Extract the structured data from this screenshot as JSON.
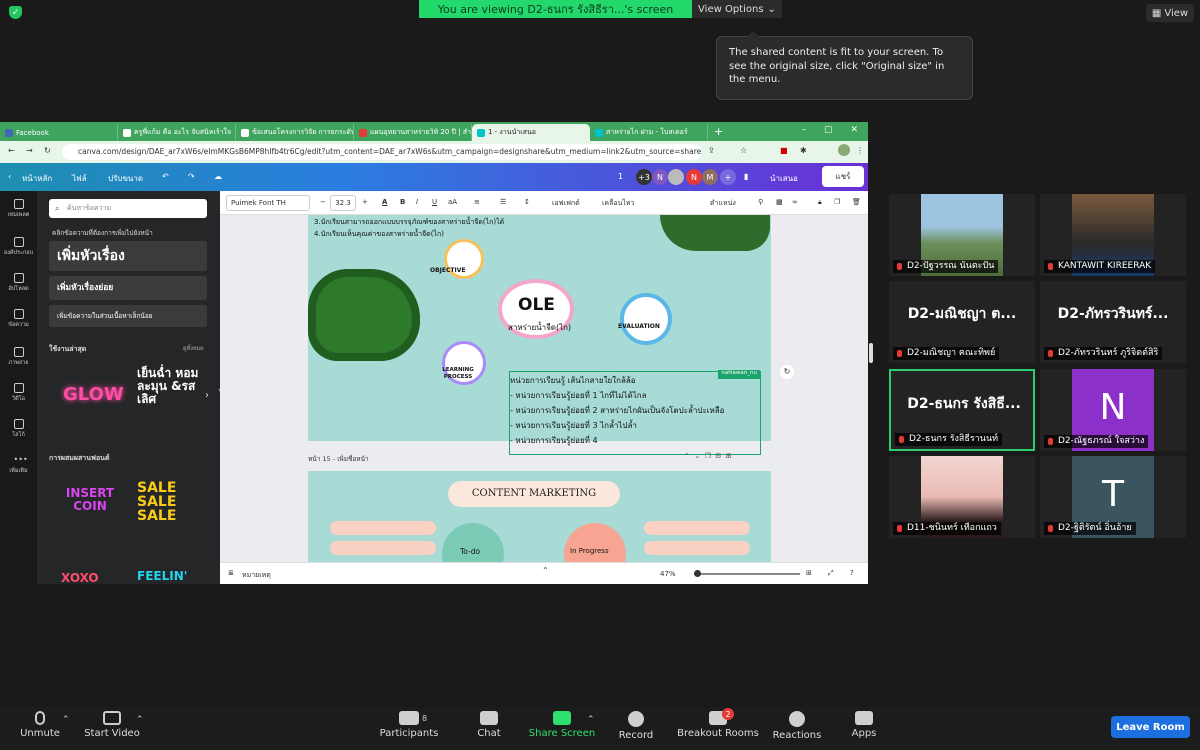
{
  "top": {
    "banner": "You are viewing D2-ธนกร รังสิธีรา...'s screen",
    "view_options": "View Options",
    "view_right": "View",
    "tooltip": "The shared content is fit to your screen. To see the original size, click \"Original size\" in the menu."
  },
  "browser": {
    "tabs": [
      "Facebook",
      "ครูพี่แก้ม คือ อะไร จับสนิทเร้าใจ",
      "ข้อเสนอโครงการวิจัย การยกระดับ",
      "แผนอุทยานสาหร่ายวิทิ 20 ปี | สำนัก",
      "1 - งานนำเสนอ",
      "สาหร่ายไก ฝาม - โบสเตอร์"
    ],
    "url": "canva.com/design/DAE_ar7xW6s/eImMKGsB6MP8hIfb4tr6Cg/edit?utm_content=DAE_ar7xW6s&utm_campaign=designshare&utm_medium=link2&utm_source=sharebutton",
    "canva_top": {
      "home": "หน้าหลัก",
      "file": "ไฟล์",
      "resize": "ปรับขนาด",
      "page_num": "1",
      "plus_count": "+3",
      "avatars": [
        "N",
        "N",
        "M"
      ],
      "present": "นำเสนอ",
      "share": "แชร์"
    },
    "leftnav": [
      "เทมเพลต",
      "องค์ประกอบ",
      "อัปโหลด",
      "ข้อความ",
      "ภาพถ่าย",
      "วิดีโอ",
      "โลโก้",
      "เพิ่มเติม"
    ],
    "panel": {
      "search_placeholder": "ค้นหาข้อความ",
      "hint": "คลิกข้อความที่ต้องการเพิ่มไปยังหน้า",
      "heading": "เพิ่มหัวเรื่อง",
      "subheading": "เพิ่มหัวเรื่องย่อย",
      "body": "เพิ่มข้อความในส่วนเนื้อหาเล็กน้อย",
      "recent": "ใช้งานล่าสุด",
      "see_all": "ดูทั้งหมด",
      "font_combos": "การผสมผสานฟอนต์",
      "samples": [
        "GLOW",
        "เย็นฉ่ำ หอมละมุน &รสเลิศ",
        "INSERT COIN",
        "SALE SALE SALE",
        "XOXO",
        "FEELIN'"
      ]
    },
    "toolbar": {
      "font": "Puimek Font TH",
      "size": "32.3",
      "effects": "เอฟเฟกต์",
      "animate": "เคลื่อนไหว",
      "position": "ตำแหน่ง"
    },
    "slide1": {
      "lines_top": [
        "3.นักเรียนสามารถออกแบบบรรจุภัณฑ์ของสาหร่ายน้ำจืด(ไก)ได้",
        "4.นักเรียนเห็นคุณค่าของสาหร่ายน้ำจืด(ไก)"
      ],
      "objective": "OBJECTIVE",
      "ole": "OLE",
      "ole_sub": "สาหร่ายน้ำจืด(ไก)",
      "evaluation": "EVALUATION",
      "learning": "LEARNING PROCESS",
      "unit_lines": [
        "หน่วยการเรียนรู้ เส้นไกสายใยใกล้ล้อ",
        "- หน่วยการเรียนรู้ย่อยที่ 1 ไกที่ไม่ได้ไกล",
        "- หน่วยการเรียนรู้ย่อยที่ 2  สาหร่ายไกผันเป็นจังโตปะล้ำปะเหลือ",
        "- หน่วยการเรียนรู้ย่อยที่ 3 ไกล้ำไปล้ำ",
        "- หน่วยการเรียนรู้ย่อยที่ 4"
      ],
      "user_tag": "nattawan_nu"
    },
    "page15": "หน้า 15 - เพิ่มชื่อหน้า",
    "slide2": {
      "title": "CONTENT MARKETING",
      "todo": "To-do",
      "inprogress": "In Progress"
    },
    "status": {
      "notes": "หมายเหตุ",
      "zoom": "47%"
    }
  },
  "gallery": [
    {
      "name": "D2-ปัฐวรรณ นันตะปัน",
      "big": ""
    },
    {
      "name": "KANTAWIT KIREERAK",
      "big": ""
    },
    {
      "name": "D2-มณิชญา ฅณะทิพย์",
      "big": "D2-มณิชญา ต..."
    },
    {
      "name": "D2-ภัทรวรินทร์ ภูริจิตต์สิริ",
      "big": "D2-ภัทรวรินทร์..."
    },
    {
      "name": "D2-ธนกร รังสิธีรานนท์",
      "big": "D2-ธนกร รังสิธี..."
    },
    {
      "name": "D2-ณัฐธภรณ์ ใจสว่าง",
      "big": "N"
    },
    {
      "name": "D11-ชนินทร์ เทือกแถว",
      "big": ""
    },
    {
      "name": "D2-ฐิติรัตน์ อิ่นอ้าย",
      "big": "T"
    }
  ],
  "bottom": {
    "unmute": "Unmute",
    "start_video": "Start Video",
    "participants": "Participants",
    "participants_count": "8",
    "chat": "Chat",
    "share_screen": "Share Screen",
    "record": "Record",
    "breakout": "Breakout Rooms",
    "breakout_badge": "2",
    "reactions": "Reactions",
    "apps": "Apps",
    "leave": "Leave Room"
  }
}
